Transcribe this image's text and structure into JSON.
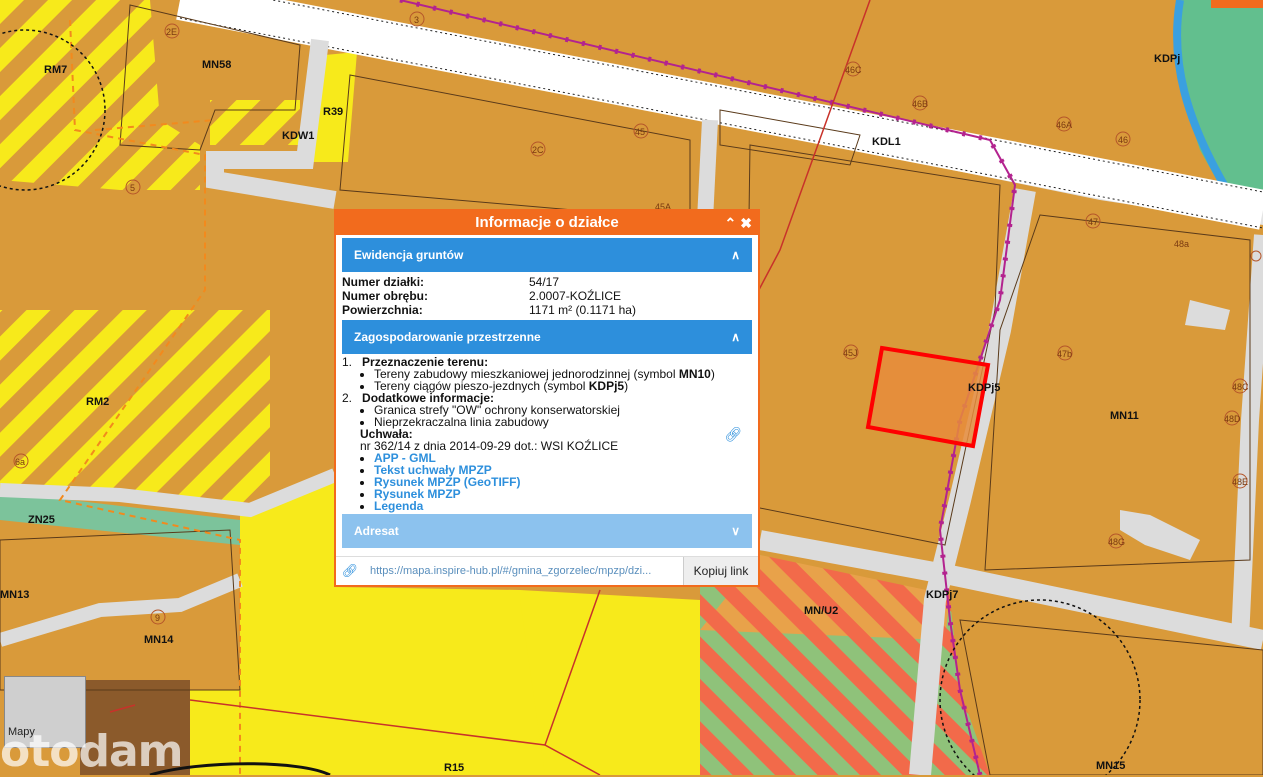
{
  "map": {
    "labels": {
      "rm7": "RM7",
      "mn58": "MN58",
      "kdw1": "KDW1",
      "r39": "R39",
      "kdl1": "KDL1",
      "kdpj": "KDPj",
      "rm2": "RM2",
      "zn25": "ZN25",
      "mn13": "MN13",
      "mn14": "MN14",
      "r15": "R15",
      "mn_u2": "MN/U2",
      "kdpj7": "KDPj7",
      "kdpj5": "KDPj5",
      "mn11": "MN11",
      "mn15": "MN15"
    },
    "circles": {
      "c2e": "2E",
      "c3": "3",
      "c46c": "46C",
      "c46b": "46B",
      "c46a": "46A",
      "c46": "46",
      "c45": "45",
      "c2c": "2C",
      "c5": "5",
      "c45a": "45A",
      "c47": "47",
      "c48a": "48a",
      "c45j": "45J",
      "c47b": "47b",
      "c48c": "48C",
      "c48d": "48D",
      "c48e": "48E",
      "c48g": "48G",
      "c6a": "6a",
      "c9": "9"
    },
    "colors": {
      "residential": "#d99a3a",
      "road": "#dcdcdc",
      "agri": "#f7ea1b",
      "green": "#7cc39b",
      "water": "#3aa0e0",
      "highlight": "#ff0000"
    }
  },
  "popup": {
    "title": "Informacje o działce",
    "collapse_icon": "chevron-up-icon",
    "close_icon": "close-icon",
    "ewidencja": {
      "heading": "Ewidencja gruntów",
      "rows": [
        {
          "key": "Numer działki:",
          "value": "54/17"
        },
        {
          "key": "Numer obrębu:",
          "value": "2.0007-KOŹLICE"
        },
        {
          "key": "Powierzchnia:",
          "value": "1171 m² (0.1171 ha)"
        }
      ]
    },
    "zagospodarowanie": {
      "heading": "Zagospodarowanie przestrzenne",
      "items": [
        {
          "num": "1.",
          "title": "Przeznaczenie terenu:",
          "bullets": [
            {
              "pre": "Tereny zabudowy mieszkaniowej jednorodzinnej (symbol ",
              "bold": "MN10",
              "post": ")"
            },
            {
              "pre": "Tereny ciągów pieszo-jezdnych (symbol ",
              "bold": "KDPj5",
              "post": ")"
            }
          ]
        },
        {
          "num": "2.",
          "title": "Dodatkowe informacje:",
          "bullets": [
            {
              "pre": "Granica strefy \"OW\" ochrony konserwatorskiej",
              "bold": "",
              "post": ""
            },
            {
              "pre": "Nieprzekraczalna linia zabudowy",
              "bold": "",
              "post": ""
            }
          ]
        }
      ],
      "uchwala_label": "Uchwała:",
      "uchwala_text": "nr 362/14 z dnia 2014-09-29 dot.: WSI KOŹLICE",
      "links": [
        "APP - GML",
        "Tekst uchwały MPZP",
        "Rysunek MPZP (GeoTIFF)",
        "Rysunek MPZP",
        "Legenda"
      ]
    },
    "adresat": {
      "heading": "Adresat"
    },
    "url": "https://mapa.inspire-hub.pl/#/gmina_zgorzelec/mpzp/dzi...",
    "copy_button": "Kopiuj link"
  },
  "minimap": {
    "label": "Mapy"
  },
  "watermark": "otodam"
}
